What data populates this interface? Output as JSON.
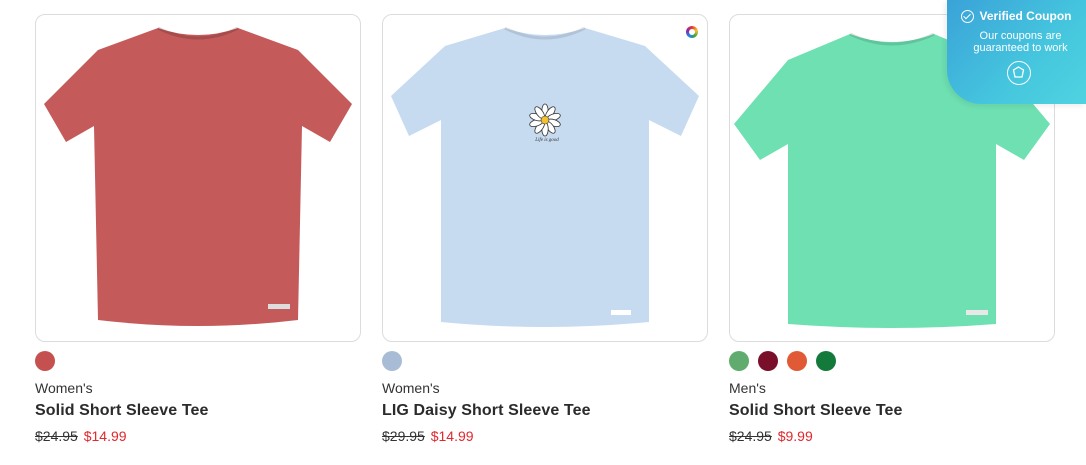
{
  "products": [
    {
      "gender": "Women's",
      "name": "Solid Short Sleeve Tee",
      "was_price": "$24.95",
      "sale_price": "$14.99",
      "shirt_color": "#c55a5a",
      "swatches": [
        "#c4514f"
      ],
      "image": "red-tee"
    },
    {
      "gender": "Women's",
      "name": "LIG Daisy Short Sleeve Tee",
      "was_price": "$29.95",
      "sale_price": "$14.99",
      "shirt_color": "#c6daf0",
      "swatches": [
        "#a9bcd6"
      ],
      "graphic_text": "Life is good",
      "image": "blue-daisy-tee"
    },
    {
      "gender": "Men's",
      "name": "Solid Short Sleeve Tee",
      "was_price": "$24.95",
      "sale_price": "$9.99",
      "shirt_color": "#6ee0b2",
      "swatches": [
        "#5fac6e",
        "#7a0f2b",
        "#e05a35",
        "#137a3c"
      ],
      "image": "mint-tee"
    }
  ],
  "coupon": {
    "title": "Verified Coupon",
    "line1": "Our coupons are",
    "line2": "guaranteed to work"
  }
}
